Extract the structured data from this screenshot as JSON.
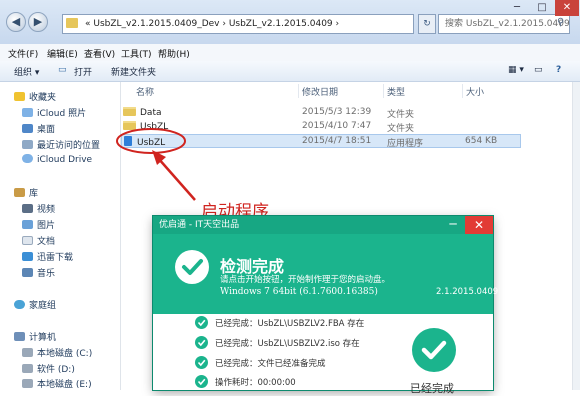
{
  "window": {
    "address_path": "« UsbZL_v2.1.2015.0409_Dev › UsbZL_v2.1.2015.0409 ›",
    "search_placeholder": "搜索 UsbZL_v2.1.2015.0409"
  },
  "menubar": [
    "文件(F)",
    "编辑(E)",
    "查看(V)",
    "工具(T)",
    "帮助(H)"
  ],
  "toolbar": {
    "organize": "组织 ▾",
    "open": "打开",
    "new_folder": "新建文件夹"
  },
  "nav": {
    "favorites": "收藏夹",
    "fav_items": [
      "iCloud 照片",
      "桌面",
      "最近访问的位置",
      "iCloud Drive"
    ],
    "library": "库",
    "lib_items": [
      "视频",
      "图片",
      "文档",
      "迅雷下载",
      "音乐"
    ],
    "homegroup": "家庭组",
    "computer": "计算机",
    "drives": [
      "本地磁盘 (C:)",
      "软件 (D:)",
      "本地磁盘 (E:)"
    ]
  },
  "columns": {
    "name": "名称",
    "date": "修改日期",
    "type": "类型",
    "size": "大小"
  },
  "files": [
    {
      "name": "Data",
      "date": "2015/5/3 12:39",
      "type": "文件夹",
      "size": ""
    },
    {
      "name": "UsbZL",
      "date": "2015/4/10 7:47",
      "type": "文件夹",
      "size": ""
    },
    {
      "name": "UsbZL",
      "date": "2015/4/7 18:51",
      "type": "应用程序",
      "size": "654 KB"
    }
  ],
  "annotation": "启动程序",
  "dialog": {
    "title": "优启通 - IT天空出品",
    "headline": "检测完成",
    "subtitle": "请点击开始按钮，开始制作理于您的启动盘。",
    "os_version": "Windows 7 64bit (6.1.7600.16385)",
    "build": "2.1.2015.0409",
    "checks": [
      "已经完成：UsbZL\\USBZLV2.FBA 存在",
      "已经完成：UsbZL\\USBZLV2.iso 存在",
      "已经完成：文件已经准备完成",
      "操作耗时：00:00:00"
    ],
    "done_label": "已经完成"
  },
  "colors": {
    "accent": "#1bb48d",
    "annotation": "#d0241f",
    "close": "#e23b35"
  }
}
